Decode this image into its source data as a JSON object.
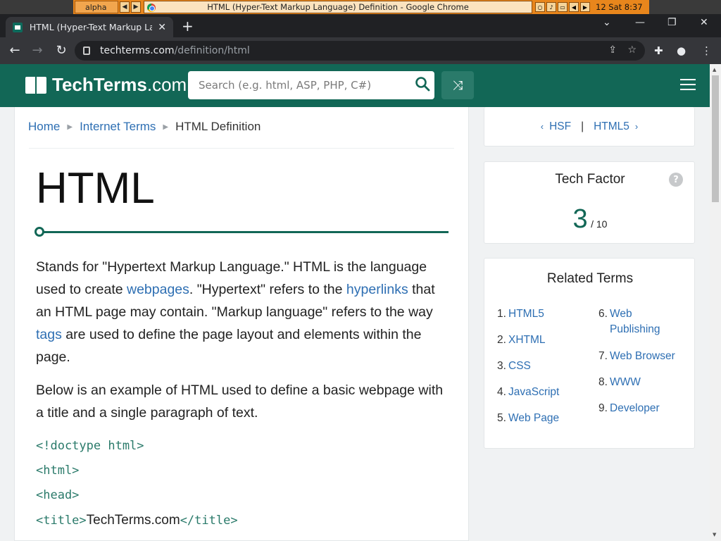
{
  "taskbar": {
    "workspace": "alpha",
    "window_title": "HTML (Hyper-Text Markup Language) Definition - Google Chrome",
    "clock": "12 Sat 8:37"
  },
  "browser": {
    "tab_title": "HTML (Hyper-Text Markup Language) Definition",
    "url_host": "techterms.com",
    "url_path": "/definition/html"
  },
  "site": {
    "brand": "TechTerms",
    "brand_suffix": ".com",
    "search_placeholder": "Search (e.g. html, ASP, PHP, C#)"
  },
  "breadcrumb": {
    "home": "Home",
    "section": "Internet Terms",
    "current": "HTML Definition"
  },
  "article": {
    "title": "HTML",
    "p1": {
      "t1": "Stands for \"Hypertext Markup Language.\" HTML is the language used to create ",
      "l1": "webpages",
      "t2": ". \"Hypertext\" refers to the ",
      "l2": "hyperlinks",
      "t3": " that an HTML page may contain. \"Markup language\" refers to the way ",
      "l3": "tags",
      "t4": " are used to define the page layout and elements within the page."
    },
    "p2": "Below is an example of HTML used to define a basic webpage with a title and a single paragraph of text.",
    "code": {
      "line1": "<!doctype html>",
      "line2": "<html>",
      "line3": "<head>",
      "line4_open": "<title>",
      "line4_text": "TechTerms.com",
      "line4_close": "</title>"
    }
  },
  "sidebar": {
    "prev": "HSF",
    "next": "HTML5",
    "sep": "|",
    "tech_factor_label": "Tech Factor",
    "tech_factor_value": "3",
    "tech_factor_max": "/ 10",
    "related_title": "Related Terms",
    "related_left": [
      {
        "n": "1.",
        "t": "HTML5"
      },
      {
        "n": "2.",
        "t": "XHTML"
      },
      {
        "n": "3.",
        "t": "CSS"
      },
      {
        "n": "4.",
        "t": "JavaScript"
      },
      {
        "n": "5.",
        "t": "Web Page"
      }
    ],
    "related_right": [
      {
        "n": "6.",
        "t": "Web Publishing"
      },
      {
        "n": "7.",
        "t": "Web Browser"
      },
      {
        "n": "8.",
        "t": "WWW"
      },
      {
        "n": "9.",
        "t": "Developer"
      }
    ]
  },
  "colors": {
    "brand_green": "#126756",
    "link_blue": "#2e6fb3"
  }
}
